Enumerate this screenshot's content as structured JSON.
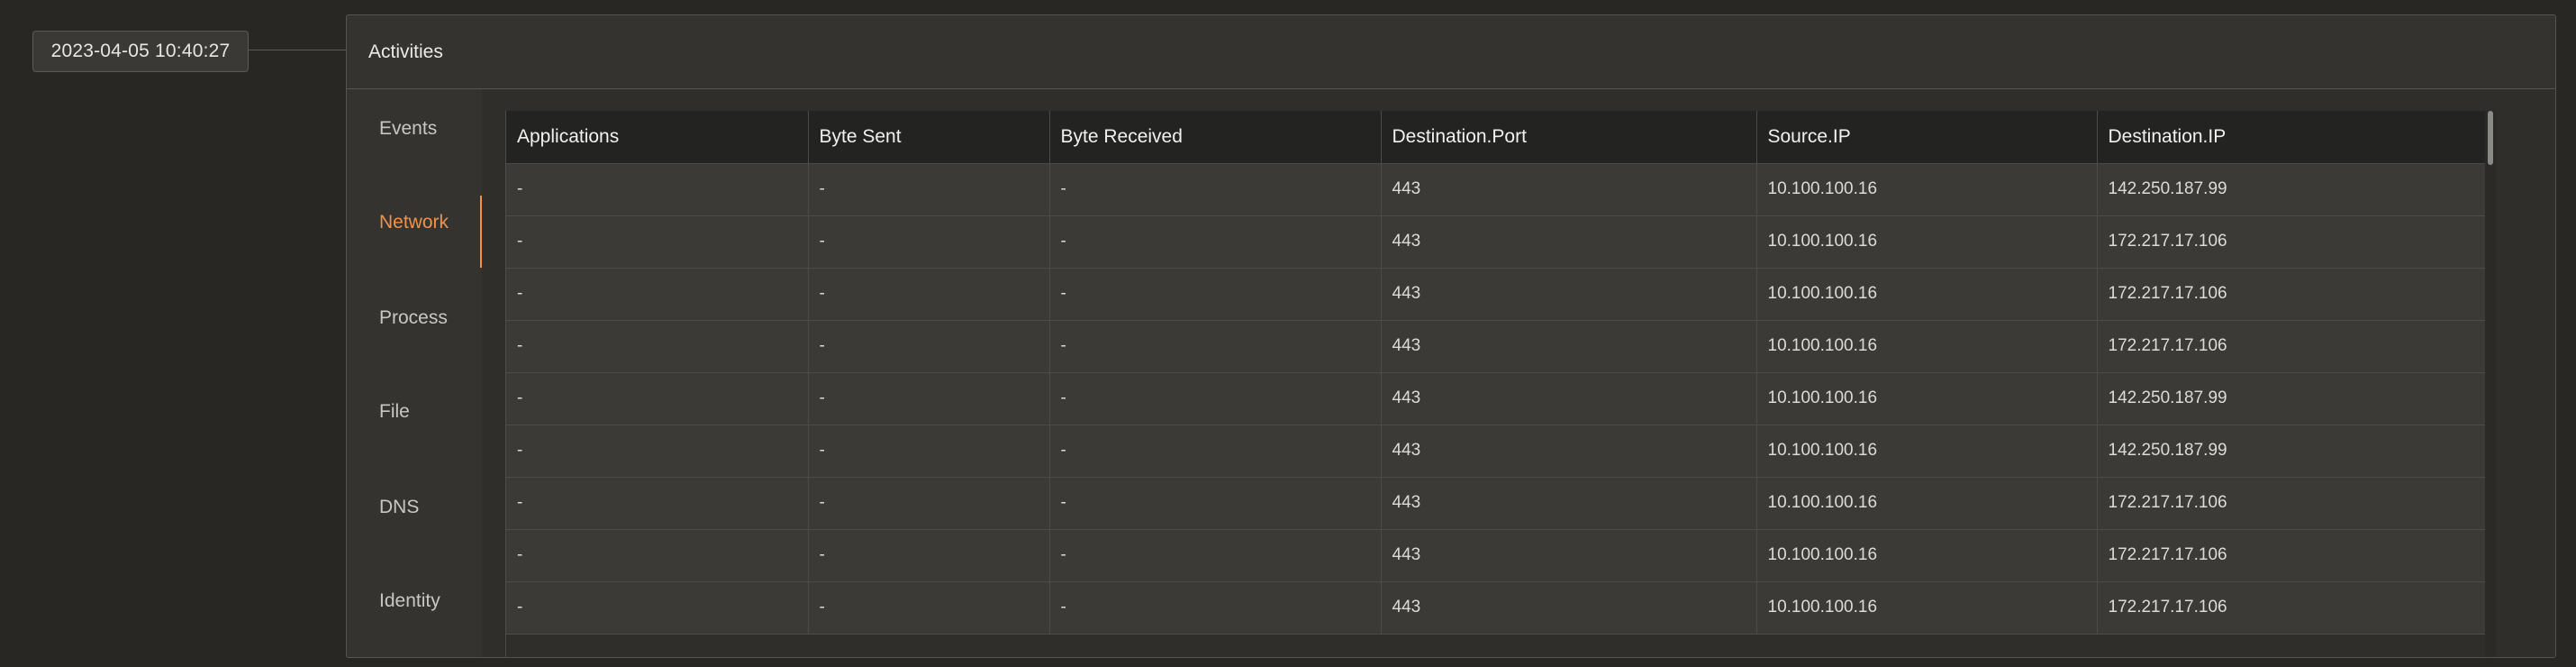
{
  "timestamp": "2023-04-05 10:40:27",
  "panel": {
    "title": "Activities"
  },
  "nav": {
    "items": [
      {
        "label": "Events",
        "active": false
      },
      {
        "label": "Network",
        "active": true
      },
      {
        "label": "Process",
        "active": false
      },
      {
        "label": "File",
        "active": false
      },
      {
        "label": "DNS",
        "active": false
      },
      {
        "label": "Identity",
        "active": false
      }
    ]
  },
  "table": {
    "columns": [
      "Applications",
      "Byte Sent",
      "Byte Received",
      "Destination.Port",
      "Source.IP",
      "Destination.IP"
    ],
    "rows": [
      [
        "-",
        "-",
        "-",
        "443",
        "10.100.100.16",
        "142.250.187.99"
      ],
      [
        "-",
        "-",
        "-",
        "443",
        "10.100.100.16",
        "172.217.17.106"
      ],
      [
        "-",
        "-",
        "-",
        "443",
        "10.100.100.16",
        "172.217.17.106"
      ],
      [
        "-",
        "-",
        "-",
        "443",
        "10.100.100.16",
        "172.217.17.106"
      ],
      [
        "-",
        "-",
        "-",
        "443",
        "10.100.100.16",
        "142.250.187.99"
      ],
      [
        "-",
        "-",
        "-",
        "443",
        "10.100.100.16",
        "142.250.187.99"
      ],
      [
        "-",
        "-",
        "-",
        "443",
        "10.100.100.16",
        "172.217.17.106"
      ],
      [
        "-",
        "-",
        "-",
        "443",
        "10.100.100.16",
        "172.217.17.106"
      ],
      [
        "-",
        "-",
        "-",
        "443",
        "10.100.100.16",
        "172.217.17.106"
      ]
    ]
  },
  "colors": {
    "accent": "#f0924a",
    "background": "#282724",
    "panel": "#34332f",
    "table_header": "#232322",
    "table_cell": "#3b3a36"
  }
}
